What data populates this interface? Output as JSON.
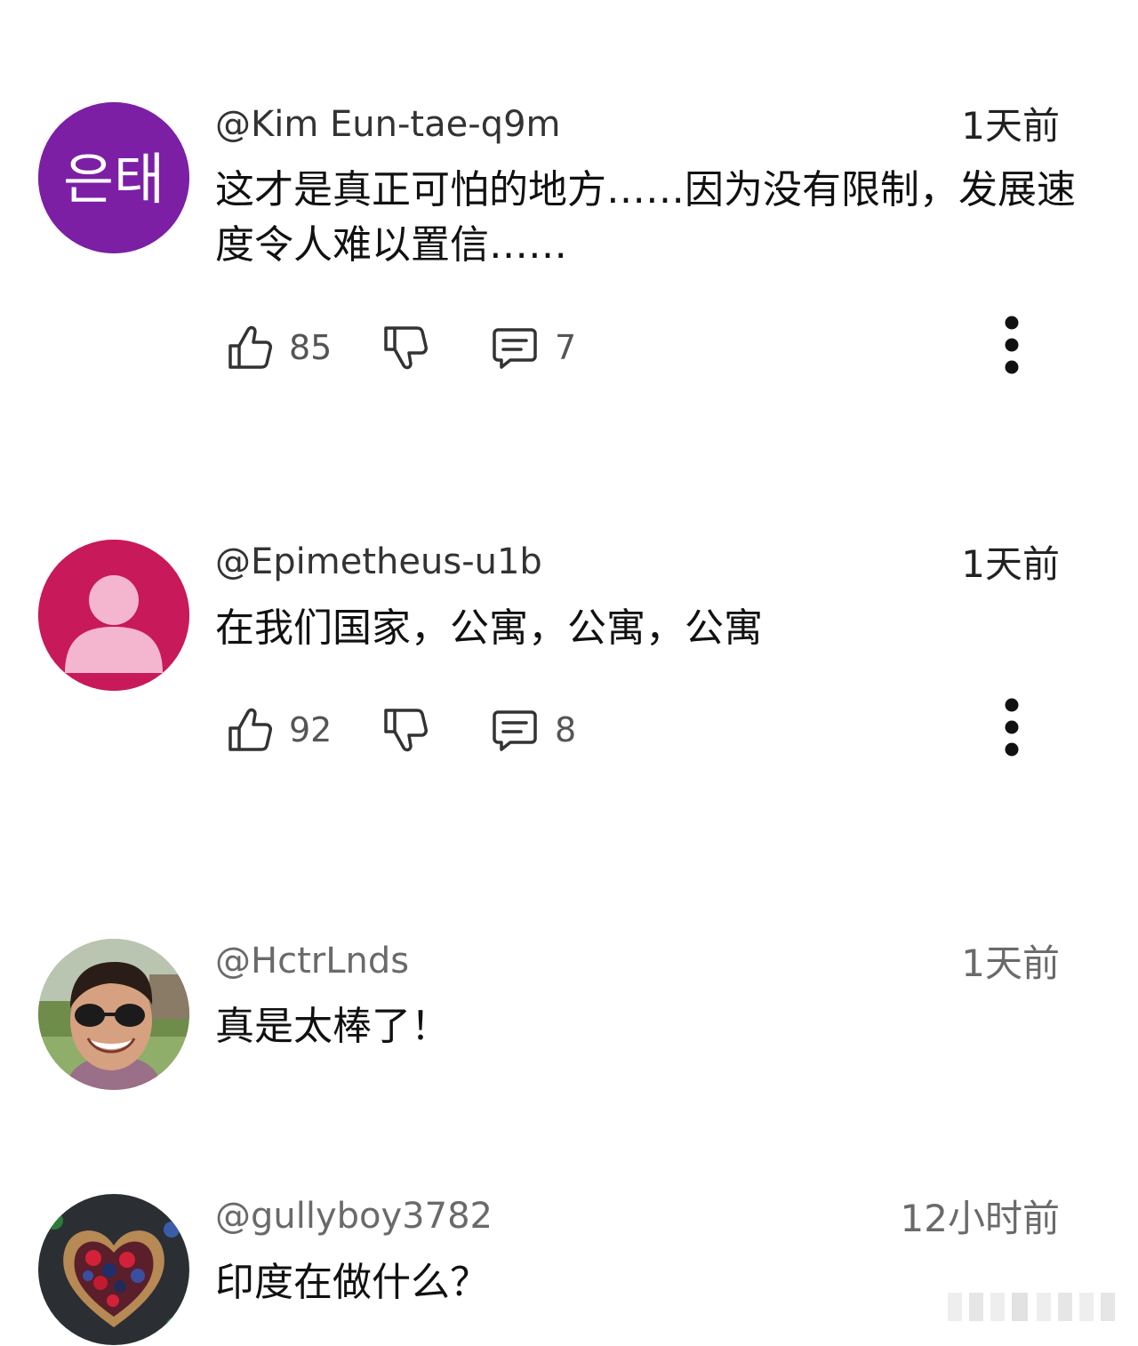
{
  "comments": [
    {
      "avatar": {
        "kind": "initials",
        "text": "은태",
        "bg": "#7c1fa5",
        "fg": "#ffffff"
      },
      "handle": "@Kim Eun-tae-q9m",
      "time": "1天前",
      "text": "这才是真正可怕的地方……因为没有限制，发展速度令人难以置信……",
      "likes": "85",
      "replies": "7"
    },
    {
      "avatar": {
        "kind": "default-person",
        "bg": "#c8195a",
        "fg": "#f4b6cf"
      },
      "handle": "@Epimetheus-u1b",
      "time": "1天前",
      "text": "在我们国家，公寓，公寓，公寓",
      "likes": "92",
      "replies": "8"
    },
    {
      "avatar": {
        "kind": "photo-man-sunglasses"
      },
      "handle": "@HctrLnds",
      "time": "1天前",
      "text": "真是太棒了！"
    },
    {
      "avatar": {
        "kind": "photo-berries-heart"
      },
      "handle": "@gullyboy3782",
      "time": "12小时前",
      "text": "印度在做什么？"
    }
  ],
  "colors": {
    "icon_stroke": "#333333",
    "muted_text": "#6a6a6a"
  }
}
